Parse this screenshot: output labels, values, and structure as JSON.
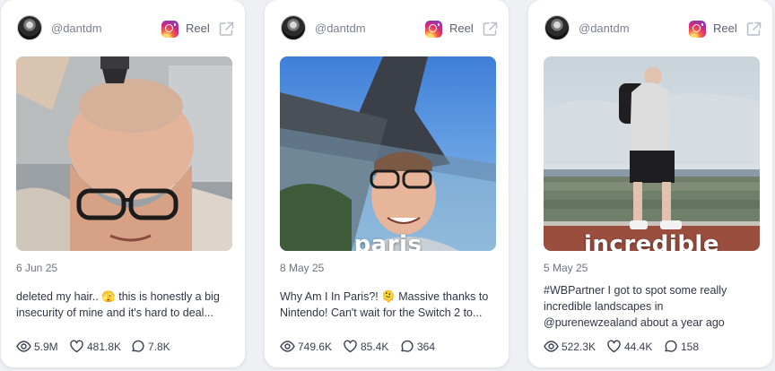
{
  "cards": [
    {
      "handle": "@dantdm",
      "type": "Reel",
      "date": "6 Jun 25",
      "caption": "deleted my hair.. 🫣 this is honestly a big insecurity of mine and it's hard to deal...",
      "overlay": "",
      "views": "5.9M",
      "likes": "481.8K",
      "comments": "7.8K"
    },
    {
      "handle": "@dantdm",
      "type": "Reel",
      "date": "8 May 25",
      "caption": "Why Am I In Paris?! 🫠 Massive thanks to Nintendo! Can't wait for the Switch 2 to...",
      "overlay": "paris",
      "views": "749.6K",
      "likes": "85.4K",
      "comments": "364"
    },
    {
      "handle": "@dantdm",
      "type": "Reel",
      "date": "5 May 25",
      "caption": "#WBPartner I got to spot some really incredible landscapes in @purenewzealand about a year ago",
      "overlay": "incredible",
      "views": "522.3K",
      "likes": "44.4K",
      "comments": "158"
    }
  ]
}
